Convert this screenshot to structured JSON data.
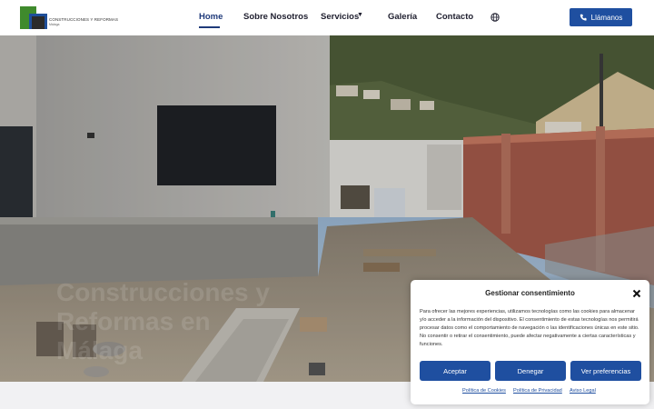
{
  "brand": {
    "logo_text": "CONSTRUCCIONES Y REFORMAS",
    "logo_sub": "Málaga"
  },
  "nav": {
    "items": [
      {
        "label": "Home"
      },
      {
        "label": "Sobre Nosotros"
      },
      {
        "label": "Servicios"
      },
      {
        "label": "Galería"
      },
      {
        "label": "Contacto"
      }
    ],
    "call_label": "Llámanos"
  },
  "hero": {
    "title_line1": "Construcciones y",
    "title_line2": "Reformas en",
    "title_line3": "Málaga"
  },
  "cookie": {
    "title": "Gestionar consentimiento",
    "body": "Para ofrecer las mejores experiencias, utilizamos tecnologías como las cookies para almacenar y/o acceder a la información del dispositivo. El consentimiento de estas tecnologías nos permitirá procesar datos como el comportamiento de navegación o las identificaciones únicas en este sitio. No consentir o retirar el consentimiento, puede afectar negativamente a ciertas características y funciones.",
    "accept": "Aceptar",
    "deny": "Denegar",
    "prefs": "Ver preferencias",
    "link_cookies": "Política de Cookies",
    "link_privacy": "Política de Privacidad",
    "link_legal": "Aviso Legal"
  },
  "colors": {
    "accent": "#1f4fa0",
    "nav_active": "#1f3a7a"
  }
}
